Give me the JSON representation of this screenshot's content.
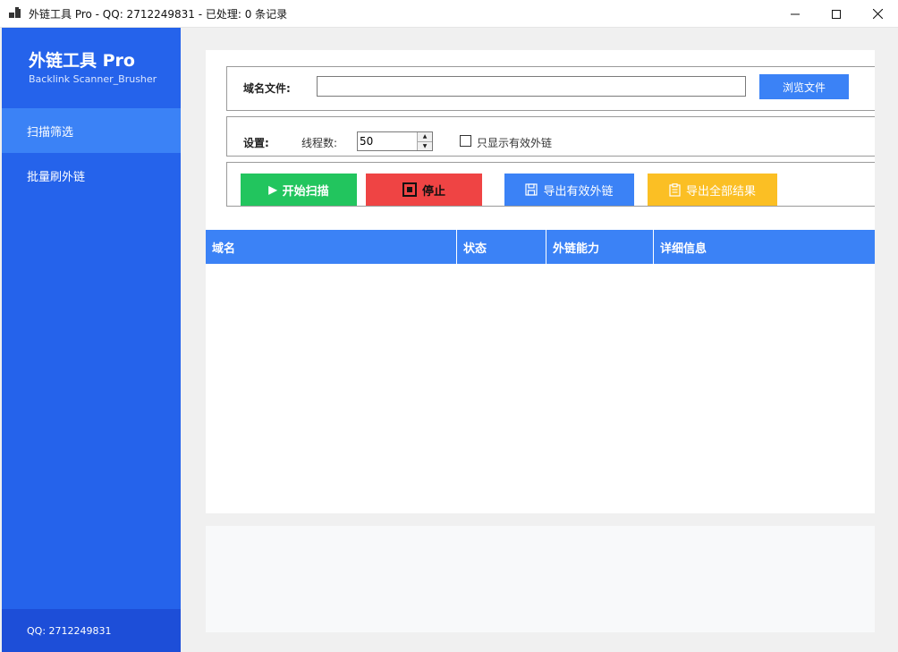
{
  "window": {
    "title": "外链工具 Pro - QQ: 2712249831 - 已处理: 0 条记录"
  },
  "sidebar": {
    "brand_title": "外链工具 Pro",
    "brand_subtitle": "Backlink Scanner_Brusher",
    "items": [
      {
        "label": "扫描筛选",
        "active": true
      },
      {
        "label": "批量刷外链",
        "active": false
      }
    ],
    "footer": "QQ: 2712249831"
  },
  "file_group": {
    "label": "域名文件:",
    "value": "",
    "browse_label": "浏览文件"
  },
  "settings_group": {
    "label": "设置:",
    "threads_label": "线程数:",
    "threads_value": "50",
    "checkbox_label": "只显示有效外链",
    "checkbox_checked": false
  },
  "actions": {
    "start_label": "开始扫描",
    "stop_label": "停止",
    "export_valid_label": "导出有效外链",
    "export_all_label": "导出全部结果"
  },
  "table": {
    "columns": [
      "域名",
      "状态",
      "外链能力",
      "详细信息"
    ],
    "rows": []
  },
  "colors": {
    "sidebar": "#2563eb",
    "sidebar_active": "#3b82f6",
    "sidebar_footer": "#1d4ed8",
    "start": "#22c55e",
    "stop": "#ef4444",
    "export_valid": "#3b82f6",
    "export_all": "#fbbf24",
    "table_header": "#3b82f6"
  }
}
